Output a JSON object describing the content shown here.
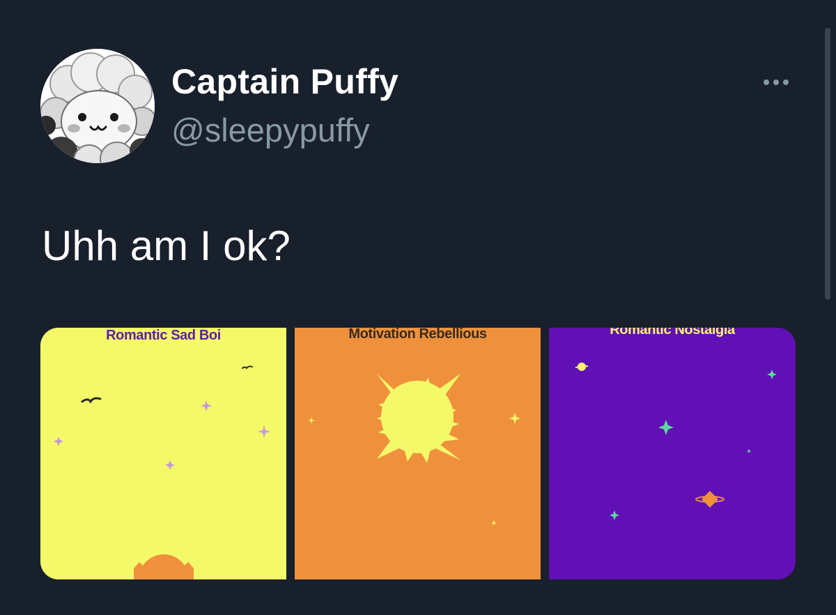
{
  "tweet": {
    "author": {
      "display_name": "Captain Puffy",
      "handle": "@sleepypuffy",
      "avatar_icon": "sheep-avatar"
    },
    "more_icon": "more-icon",
    "text": "Uhh am I ok?"
  },
  "media": [
    {
      "title": "Romantic Sad Boi",
      "background": "#f4f96a",
      "title_color": "#5b1fa6",
      "icons": [
        "bird-icon",
        "sparkle-icon",
        "sun-icon"
      ]
    },
    {
      "title": "Motivation Rebellious",
      "background": "#ef913c",
      "title_color": "#3a2a1a",
      "icons": [
        "sun-icon",
        "sparkle-icon"
      ]
    },
    {
      "title": "Romantic Nostalgia",
      "background": "#6010b5",
      "title_color": "#f4f96a",
      "icons": [
        "planet-icon",
        "sparkle-icon"
      ]
    }
  ],
  "colors": {
    "background": "#18202c",
    "text_primary": "#ffffff",
    "text_secondary": "#8899a6"
  }
}
